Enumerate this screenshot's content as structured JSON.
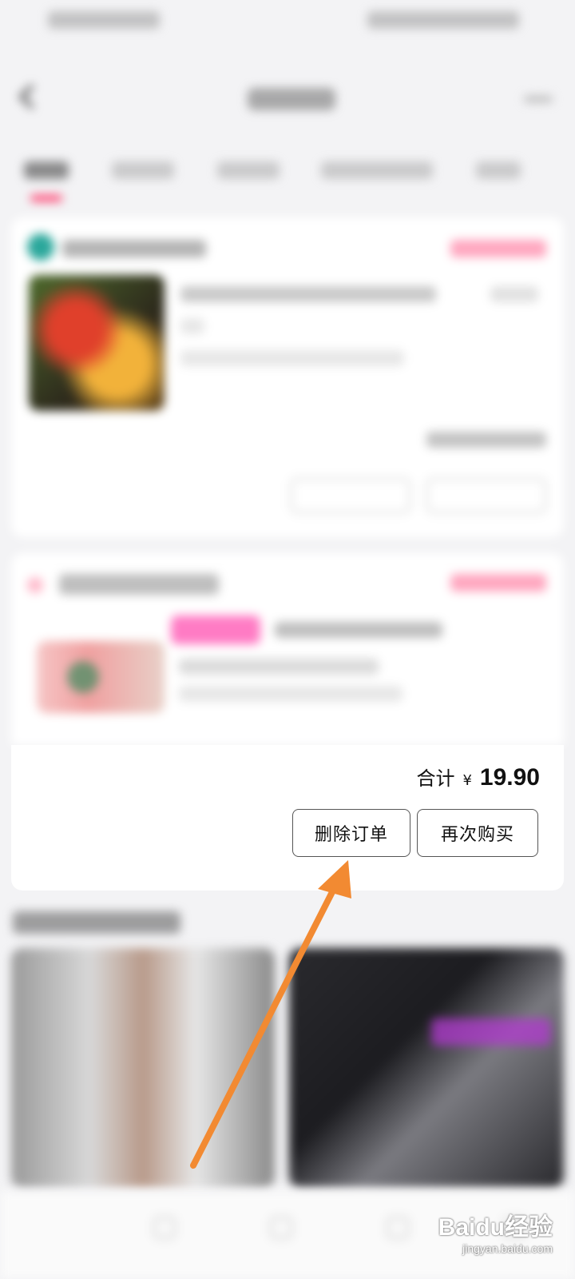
{
  "order": {
    "total_label": "合计",
    "currency": "¥",
    "total_amount": "19.90",
    "actions": {
      "delete_label": "删除订单",
      "rebuy_label": "再次购买"
    }
  },
  "accent_color": "#ff3b6b",
  "annotation_arrow_color": "#f28a32",
  "watermark": {
    "main": "Baidu经验",
    "sub": "jingyan.baidu.com"
  }
}
